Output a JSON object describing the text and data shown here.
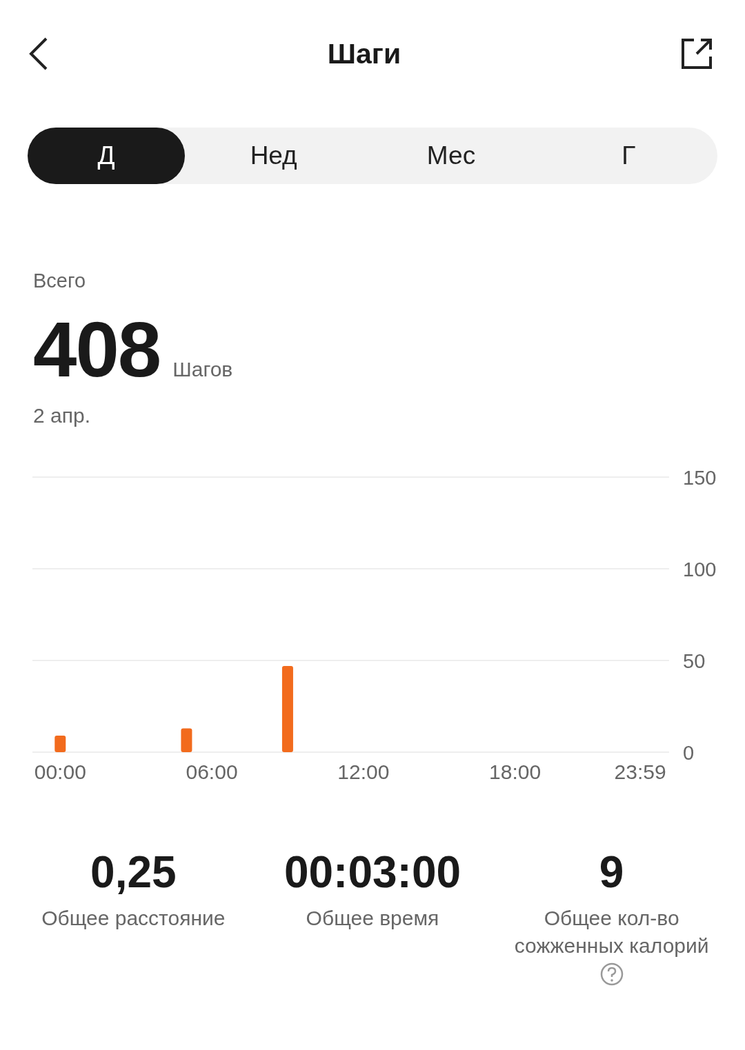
{
  "header": {
    "title": "Шаги"
  },
  "tabs": [
    {
      "label": "Д",
      "selected": true
    },
    {
      "label": "Нед",
      "selected": false
    },
    {
      "label": "Мес",
      "selected": false
    },
    {
      "label": "Г",
      "selected": false
    }
  ],
  "summary": {
    "label": "Всего",
    "value": "408",
    "unit": "Шагов",
    "date": "2 апр."
  },
  "chart_data": {
    "type": "bar",
    "x": [
      0,
      5,
      9
    ],
    "values": [
      9,
      13,
      47
    ],
    "xlim": [
      -1.1,
      24.1
    ],
    "ylim": [
      0,
      150
    ],
    "yticks": [
      0,
      50,
      100,
      150
    ],
    "xticks": [
      {
        "value": 0,
        "label": "00:00"
      },
      {
        "value": 6,
        "label": "06:00"
      },
      {
        "value": 12,
        "label": "12:00"
      },
      {
        "value": 18,
        "label": "18:00"
      },
      {
        "value": 23.98,
        "label": "23:59"
      }
    ]
  },
  "stats": [
    {
      "value": "0,25",
      "label": "Общее расстояние",
      "help": false
    },
    {
      "value": "00:03:00",
      "label": "Общее время",
      "help": false
    },
    {
      "value": "9",
      "label": "Общее кол-во сожженных калорий",
      "help": true
    }
  ]
}
